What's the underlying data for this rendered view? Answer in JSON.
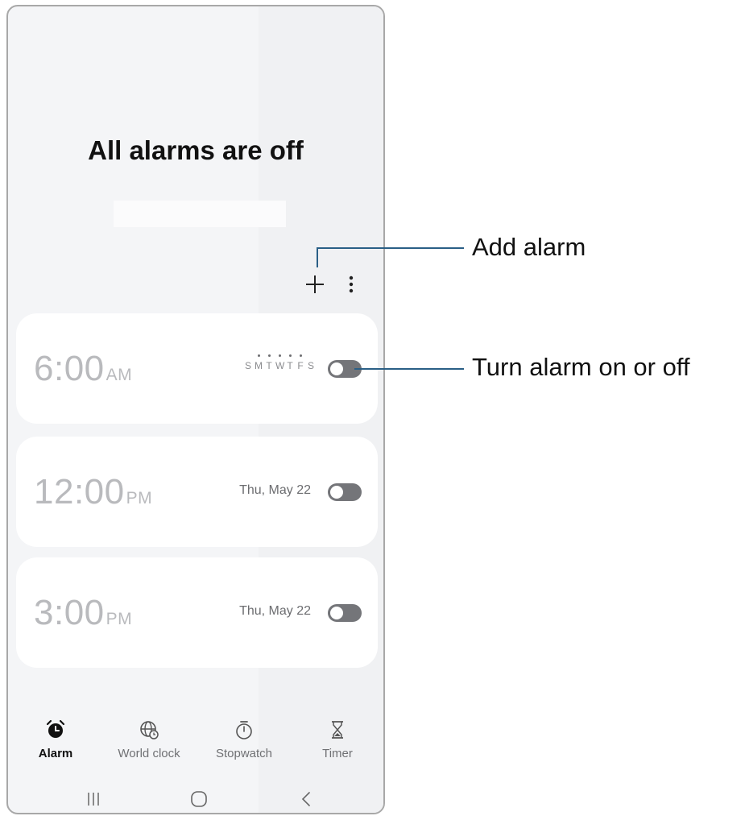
{
  "header": {
    "title": "All alarms are off"
  },
  "toolbar": {
    "add_icon": "plus-icon",
    "more_icon": "more-vertical-icon"
  },
  "alarms": [
    {
      "time": "6:00",
      "ampm": "AM",
      "days": [
        "S",
        "M",
        "T",
        "W",
        "T",
        "F",
        "S"
      ],
      "enabled": false
    },
    {
      "time": "12:00",
      "ampm": "PM",
      "date": "Thu, May 22",
      "enabled": false
    },
    {
      "time": "3:00",
      "ampm": "PM",
      "date": "Thu, May 22",
      "enabled": false
    }
  ],
  "tabs": [
    {
      "label": "Alarm",
      "icon": "alarm-clock-icon",
      "active": true
    },
    {
      "label": "World clock",
      "icon": "globe-clock-icon",
      "active": false
    },
    {
      "label": "Stopwatch",
      "icon": "stopwatch-icon",
      "active": false
    },
    {
      "label": "Timer",
      "icon": "hourglass-icon",
      "active": false
    }
  ],
  "navbar": {
    "recents_icon": "recents-icon",
    "home_icon": "home-icon",
    "back_icon": "back-icon"
  },
  "callouts": {
    "add": "Add alarm",
    "toggle": "Turn alarm on or off"
  },
  "colors": {
    "toggle_off": "#747579",
    "callout_line": "#2a5f86",
    "background": "#f4f5f7",
    "card": "#ffffff"
  }
}
